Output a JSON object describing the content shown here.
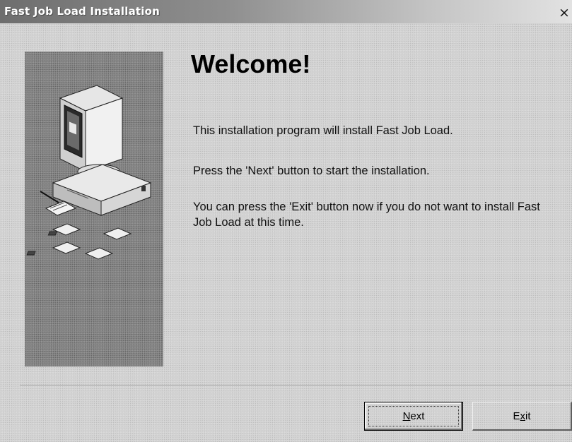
{
  "window": {
    "title": "Fast Job Load Installation",
    "close_label": "×"
  },
  "content": {
    "heading": "Welcome!",
    "paragraphs": [
      "This installation program will install Fast Job Load.",
      "Press the 'Next' button to start the installation.",
      "You can press the 'Exit' button now if you do not want to install Fast Job Load at this time."
    ]
  },
  "buttons": {
    "next": {
      "label": "Next",
      "mnemonic": "N"
    },
    "exit": {
      "label": "Exit",
      "mnemonic": "x"
    }
  },
  "illustration": {
    "icon": "computer-with-disks-icon"
  }
}
